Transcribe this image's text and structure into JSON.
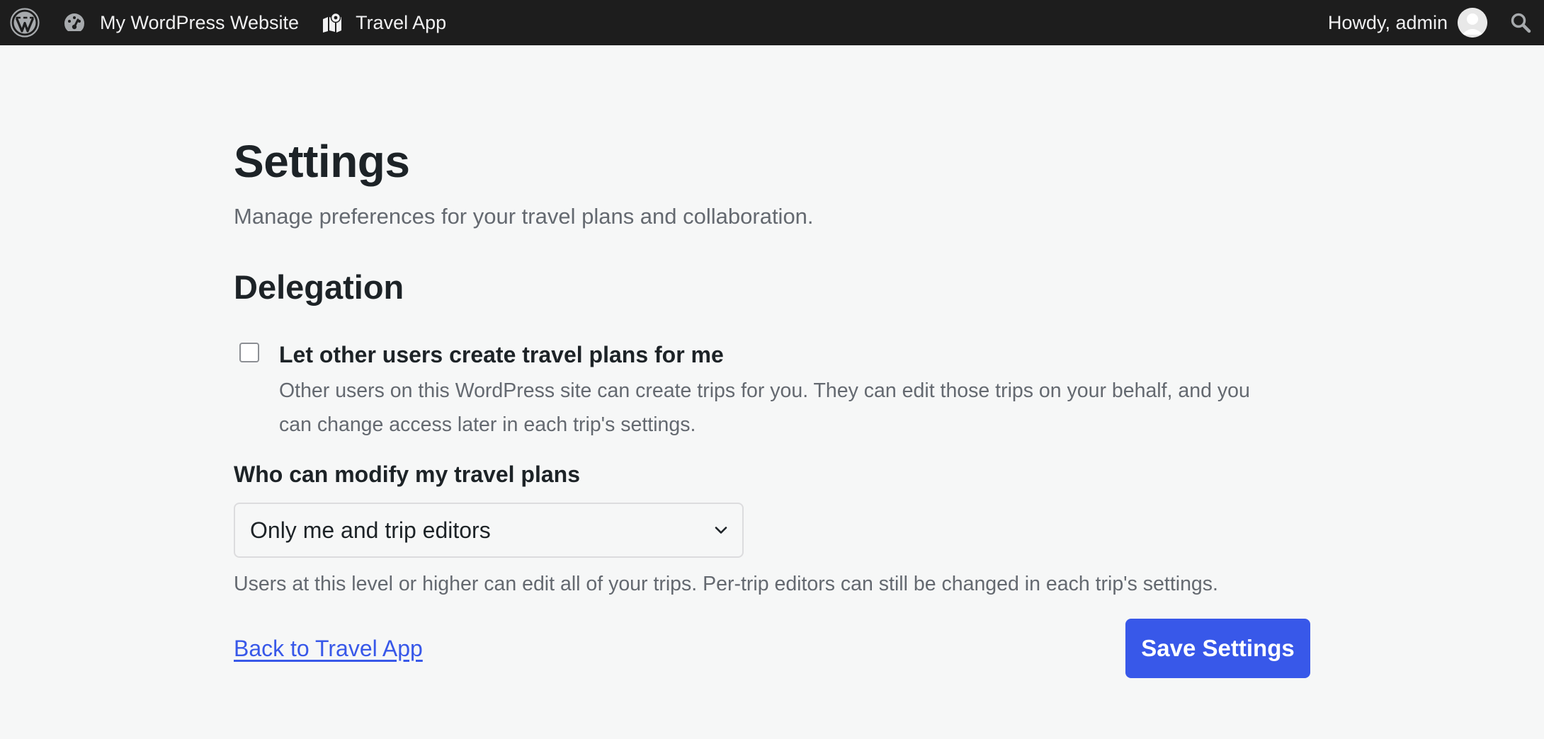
{
  "adminbar": {
    "wp_logo_icon": "wordpress-logo-icon",
    "site_icon": "dashboard-gauge-icon",
    "site_name": "My WordPress Website",
    "app_icon": "map-pin-icon",
    "app_name": "Travel App",
    "howdy": "Howdy, admin",
    "avatar_icon": "user-avatar-icon",
    "search_icon": "search-icon"
  },
  "page": {
    "title": "Settings",
    "description": "Manage preferences for your travel plans and collaboration."
  },
  "delegation": {
    "title": "Delegation",
    "checkbox_label": "Let other users create travel plans for me",
    "checkbox_checked": false,
    "checkbox_help_line1": "Other users on this WordPress site can create trips for you. They can edit those trips on your behalf, and you",
    "checkbox_help_line2": "can change access later in each trip's settings.",
    "modify_label": "Who can modify my travel plans",
    "modify_selected": "Only me and trip editors",
    "modify_help": "Users at this level or higher can edit all of your trips. Per-trip editors can still be changed in each trip's settings."
  },
  "actions": {
    "back_link": "Back to Travel App",
    "save_button": "Save Settings"
  },
  "colors": {
    "adminbar_bg": "#1d1d1d",
    "page_bg": "#f6f7f7",
    "accent": "#3858e9",
    "text": "#1d2327",
    "muted": "#646970"
  }
}
